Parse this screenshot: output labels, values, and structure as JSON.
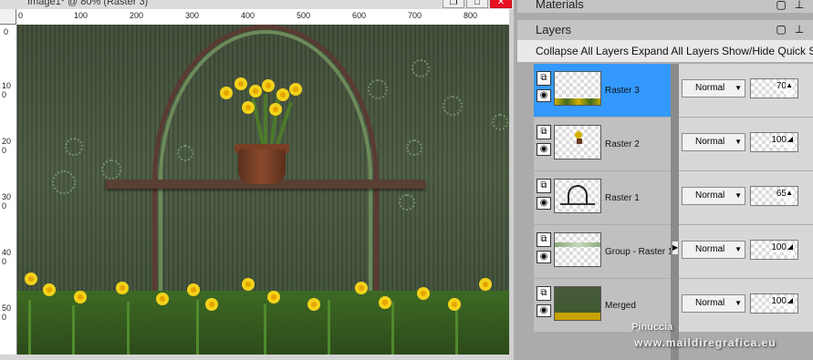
{
  "image_window": {
    "title": "Image1* @ 80% (Raster 3)",
    "buttons": {
      "restore": "❐",
      "maximize": "□",
      "close": "✕"
    },
    "ruler_h": [
      "0",
      "100",
      "200",
      "300",
      "400",
      "500",
      "600",
      "700",
      "800"
    ],
    "ruler_v": [
      "0",
      "100",
      "200",
      "300",
      "400",
      "500"
    ]
  },
  "materials": {
    "title": "Materials"
  },
  "layers": {
    "title": "Layers",
    "toolbar": {
      "collapse": "Collapse All Layers",
      "expand": "Expand All Layers",
      "quick": "Show/Hide Quick Se"
    },
    "rows": [
      {
        "name": "Raster 3",
        "blend": "Normal",
        "opacity": "70",
        "selected": true
      },
      {
        "name": "Raster 2",
        "blend": "Normal",
        "opacity": "100",
        "selected": false
      },
      {
        "name": "Raster 1",
        "blend": "Normal",
        "opacity": "65",
        "selected": false
      },
      {
        "name": "Group - Raster 1",
        "blend": "Normal",
        "opacity": "100",
        "selected": false
      },
      {
        "name": "Merged",
        "blend": "Normal",
        "opacity": "100",
        "selected": false
      }
    ]
  },
  "watermark": {
    "line1": "Pinuccia",
    "line2": "www.maildiregrafica.eu"
  }
}
